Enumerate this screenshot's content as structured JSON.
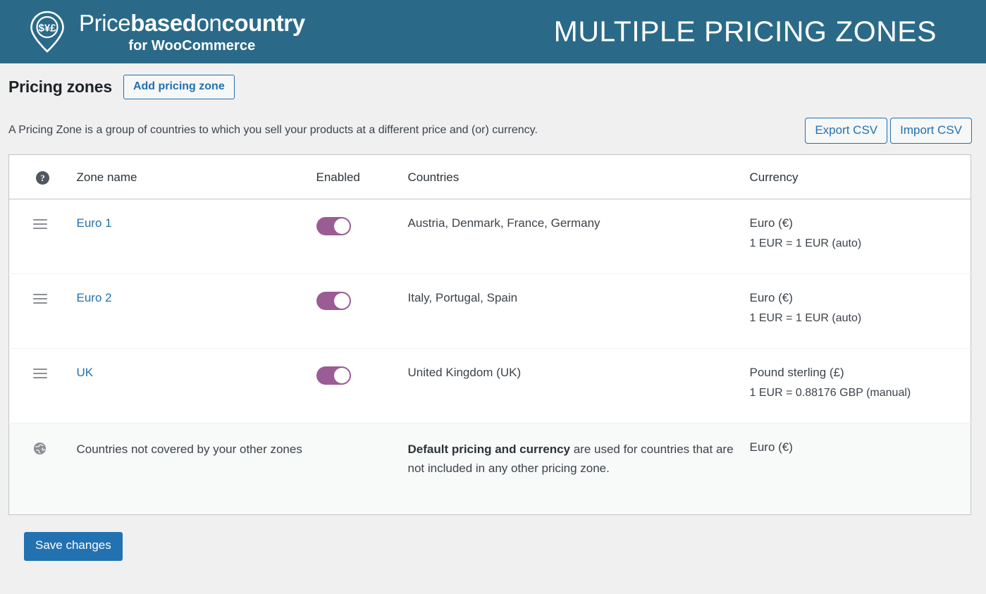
{
  "banner": {
    "logo": {
      "icon": "map-pin-currency-icon",
      "symbols": "$¥£",
      "line1_part1": "Price",
      "line1_part2": "based",
      "line1_part3": "on",
      "line1_part4": "country",
      "line2": "for WooCommerce"
    },
    "title": "MULTIPLE PRICING ZONES",
    "bg_color": "#2a6a88"
  },
  "header": {
    "page_title": "Pricing zones",
    "add_zone_label": "Add pricing zone",
    "description": "A Pricing Zone is a group of countries to which you sell your products at a different price and (or) currency.",
    "export_csv_label": "Export CSV",
    "import_csv_label": "Import CSV"
  },
  "table": {
    "columns": {
      "help": "?",
      "zone_name": "Zone name",
      "enabled": "Enabled",
      "countries": "Countries",
      "currency": "Currency"
    },
    "rows": [
      {
        "handle": "drag-handle-icon",
        "name": "Euro 1",
        "enabled": true,
        "countries": "Austria, Denmark, France, Germany",
        "currency_name": "Euro (€)",
        "currency_rate": "1 EUR = 1 EUR (auto)"
      },
      {
        "handle": "drag-handle-icon",
        "name": "Euro 2",
        "enabled": true,
        "countries": "Italy, Portugal, Spain",
        "currency_name": "Euro (€)",
        "currency_rate": "1 EUR = 1 EUR (auto)"
      },
      {
        "handle": "drag-handle-icon",
        "name": "UK",
        "enabled": true,
        "countries": "United Kingdom (UK)",
        "currency_name": "Pound sterling (£)",
        "currency_rate": "1 EUR = 0.88176 GBP (manual)"
      }
    ],
    "default_row": {
      "icon": "globe-icon",
      "label": "Countries not covered by your other zones",
      "description_bold": "Default pricing and currency",
      "description_rest": " are used for countries that are not included in any other pricing zone.",
      "currency_name": "Euro (€)"
    }
  },
  "footer": {
    "save_label": "Save changes"
  },
  "colors": {
    "banner": "#2a6a88",
    "link": "#2271b1",
    "toggle_on": "#9a5c94",
    "primary_button": "#2271b1",
    "page_bg": "#f0f0f1"
  }
}
